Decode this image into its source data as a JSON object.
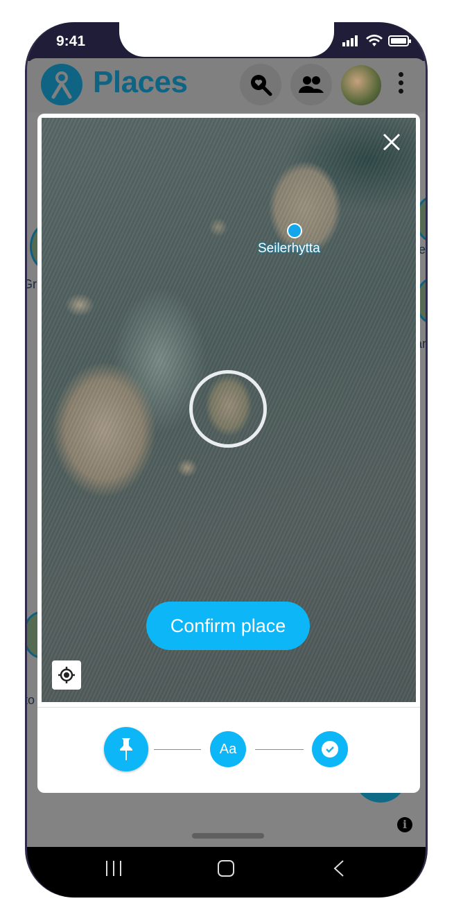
{
  "status_bar": {
    "time": "9:41"
  },
  "app_bar": {
    "title": "Places",
    "icons": [
      "logo-icon",
      "heart-search-icon",
      "people-icon",
      "avatar",
      "kebab-menu-icon"
    ]
  },
  "background": {
    "labels": [
      "Gr",
      "fe",
      "an",
      "to"
    ]
  },
  "dialog": {
    "poi_label": "Seilerhytta",
    "confirm_label": "Confirm place",
    "steps": [
      {
        "icon": "pushpin-icon",
        "active": true
      },
      {
        "label": "Aa",
        "active": false
      },
      {
        "icon": "check-circle-icon",
        "active": false
      }
    ]
  },
  "colors": {
    "accent": "#0db6f6",
    "brand": "#0f6484"
  }
}
